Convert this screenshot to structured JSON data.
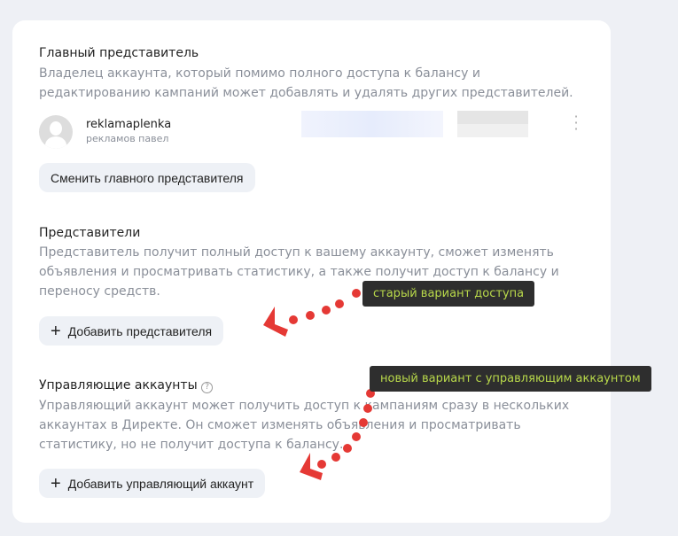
{
  "main_rep": {
    "title": "Главный представитель",
    "desc": "Владелец аккаунта, который помимо полного доступа к балансу и редактированию кампаний может добавлять и удалять других представителей.",
    "login": "reklamaplenka",
    "name": "рекламов павел",
    "change_button": "Сменить главного представителя"
  },
  "reps": {
    "title": "Представители",
    "desc": "Представитель получит полный доступ к вашему аккаунту, сможет изменять объявления и просматривать статистику, а также получит доступ к балансу и переносу средств.",
    "add_button": "Добавить представителя"
  },
  "managing": {
    "title": "Управляющие аккаунты",
    "help_icon": "?",
    "desc": "Управляющий аккаунт может получить доступ к кампаниям сразу в нескольких аккаунтах в Директе. Он сможет изменять объявления и просматривать статистику, но не получит доступа к балансу.",
    "add_button": "Добавить управляющий аккаунт"
  },
  "annotations": {
    "old": "старый вариант доступа",
    "new": "новый вариант с управляющим аккаунтом"
  },
  "colors": {
    "arrow": "#e53935",
    "tip_text": "#b8d84a"
  }
}
